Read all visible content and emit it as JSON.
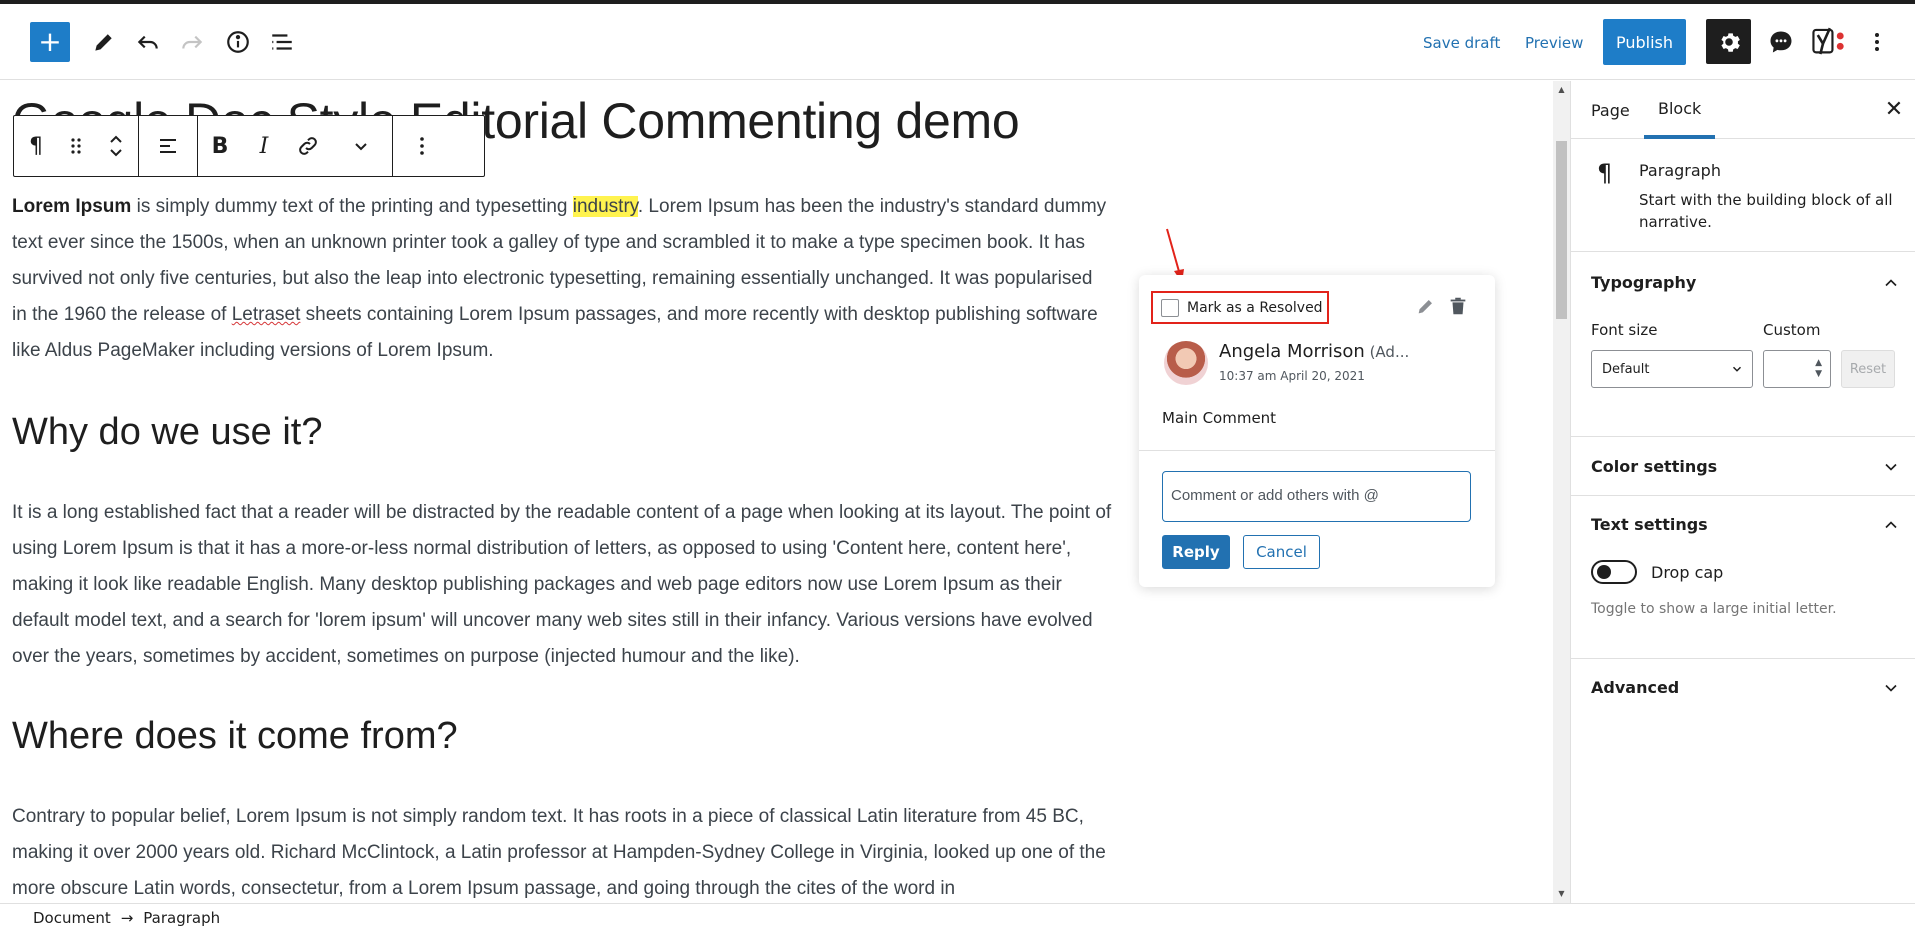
{
  "header": {
    "inserter_label": "+",
    "save_draft": "Save draft",
    "preview": "Preview",
    "publish": "Publish",
    "icons": [
      "pencil-icon",
      "undo-icon",
      "redo-icon",
      "info-icon",
      "list-view-icon",
      "gear-icon",
      "comment-bubble-icon",
      "yoast-icon",
      "more-vertical-icon"
    ]
  },
  "block_toolbar": {
    "paragraph_symbol": "¶",
    "bold": "B",
    "italic": "I"
  },
  "post": {
    "title": "Google Doc Style Editorial Commenting demo",
    "p1_bold": "Lorem Ipsum",
    "p1_a": " is simply dummy text of the printing and typesetting ",
    "p1_highlight": "industry",
    "p1_b": ". Lorem Ipsum has been the industry's standard dummy text ever since the 1500s, when an unknown printer took a galley of type and scrambled it to make a type specimen book. It has survived not only five centuries, but also the leap into electronic typesetting, remaining essentially unchanged. It was popularised in the 1960 the release of ",
    "p1_spell": "Letraset",
    "p1_c": " sheets containing Lorem Ipsum passages, and more recently with desktop publishing software like Aldus PageMaker including versions of Lorem Ipsum.",
    "h2_1": "Why do we use it?",
    "p2": "It is a long established fact that a reader will be distracted by the readable content of a page when looking at its layout. The point of using Lorem Ipsum is that it has a more-or-less normal distribution of letters, as opposed to using 'Content here, content here', making it look like readable English. Many desktop publishing packages and web page editors now use Lorem Ipsum as their default model text, and a search for 'lorem ipsum' will uncover many web sites still in their infancy. Various versions have evolved over the years, sometimes by accident, sometimes on purpose (injected humour and the like).",
    "h2_2": "Where does it come from?",
    "p3": "Contrary to popular belief, Lorem Ipsum is not simply random text. It has roots in a piece of classical Latin literature from 45 BC, making it over 2000 years old. Richard McClintock, a Latin professor at Hampden-Sydney College in Virginia, looked up one of the more obscure Latin words, consectetur, from a Lorem Ipsum passage, and going through the cites of the word in"
  },
  "comment": {
    "resolve_label": "Mark as a Resolved",
    "author": "Angela Morrison",
    "author_role": " (Ad...",
    "timestamp": "10:37 am April 20, 2021",
    "text": "Main Comment",
    "reply_placeholder": "Comment or add others with @",
    "reply_button": "Reply",
    "cancel_button": "Cancel"
  },
  "sidebar": {
    "tabs": [
      {
        "label": "Page",
        "active": false
      },
      {
        "label": "Block",
        "active": true
      }
    ],
    "block": {
      "icon": "¶",
      "name": "Paragraph",
      "description": "Start with the building block of all narrative."
    },
    "typography": {
      "title": "Typography",
      "font_size_label": "Font size",
      "custom_label": "Custom",
      "font_size_value": "Default",
      "reset": "Reset"
    },
    "color_settings": "Color settings",
    "text_settings": {
      "title": "Text settings",
      "drop_cap_label": "Drop cap",
      "drop_cap_enabled": false,
      "help": "Toggle to show a large initial letter."
    },
    "advanced": "Advanced"
  },
  "footer": {
    "breadcrumbs": [
      "Document",
      "Paragraph"
    ],
    "separator": "→"
  },
  "colors": {
    "accent": "#2271b1",
    "highlight": "#fff34f",
    "annotation_red": "#e2231a"
  }
}
